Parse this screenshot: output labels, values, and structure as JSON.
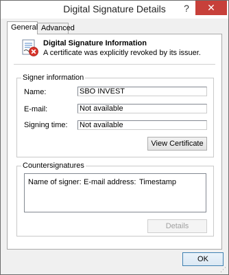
{
  "window": {
    "title": "Digital Signature Details",
    "help_glyph": "?",
    "close_glyph": "✕"
  },
  "tabs": [
    {
      "label": "General",
      "selected": true
    },
    {
      "label": "Advanced",
      "selected": false
    }
  ],
  "info": {
    "title": "Digital Signature Information",
    "message": "A certificate was explicitly revoked by its issuer."
  },
  "signer": {
    "legend": "Signer information",
    "fields": [
      {
        "label": "Name:",
        "value": "SBO INVEST"
      },
      {
        "label": "E-mail:",
        "value": "Not available"
      },
      {
        "label": "Signing time:",
        "value": "Not available"
      }
    ],
    "view_button": "View Certificate"
  },
  "countersignatures": {
    "legend": "Countersignatures",
    "columns": [
      "Name of signer:",
      "E-mail address:",
      "Timestamp"
    ],
    "details_button": "Details"
  },
  "footer": {
    "ok_button": "OK"
  },
  "icons": {
    "certificate": "certificate-revoked-icon",
    "help": "help-icon",
    "close": "close-icon",
    "grip": "resize-grip-icon"
  },
  "colors": {
    "close_bg": "#c7403a",
    "error_badge": "#d9342b",
    "ok_border": "#3c7fb1"
  }
}
